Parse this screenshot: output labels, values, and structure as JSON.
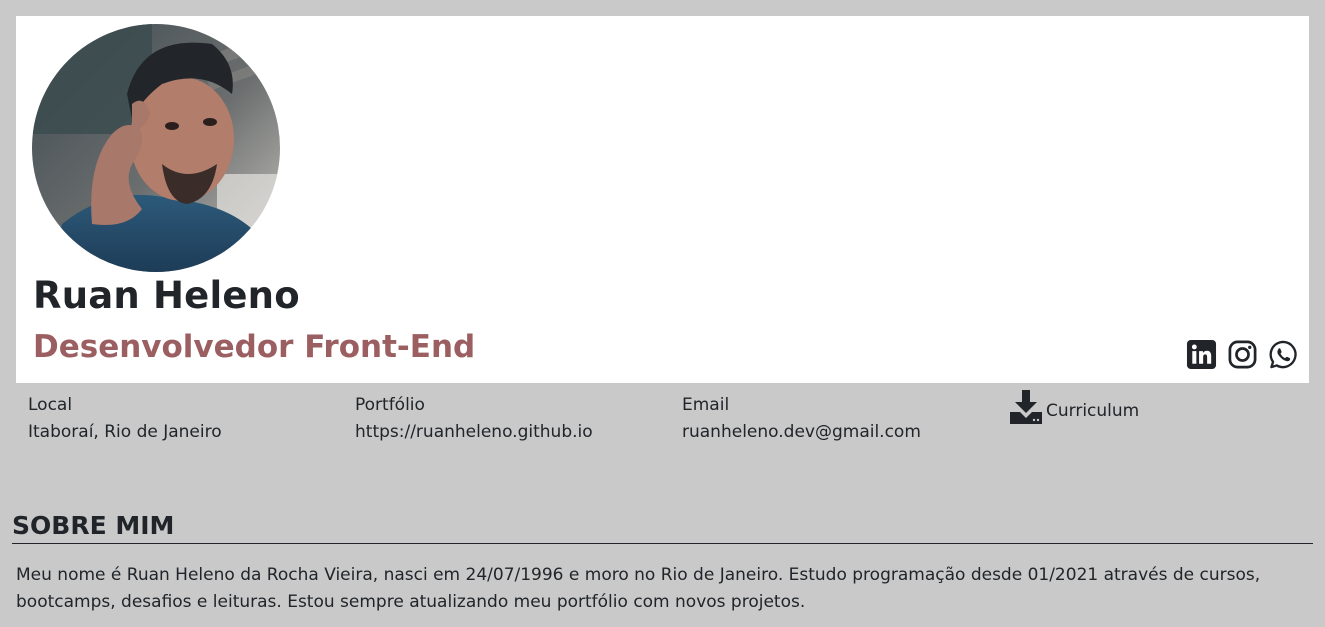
{
  "profile": {
    "name": "Ruan Heleno",
    "role": "Desenvolvedor Front-End",
    "photo_alt": "Foto de perfil"
  },
  "socials": [
    {
      "icon": "linkedin-icon"
    },
    {
      "icon": "instagram-icon"
    },
    {
      "icon": "whatsapp-icon"
    }
  ],
  "info": {
    "local_label": "Local",
    "local_value": "Itaboraí, Rio de Janeiro",
    "portfolio_label": "Portfólio",
    "portfolio_value": "https://ruanheleno.github.io",
    "email_label": "Email",
    "email_value": "ruanheleno.dev@gmail.com",
    "cv_label": "Curriculum",
    "cv_icon": "download-icon"
  },
  "about": {
    "title": "SOBRE MIM",
    "text": "Meu nome é Ruan Heleno da Rocha Vieira, nasci em 24/07/1996 e moro no Rio de Janeiro. Estudo programação desde 01/2021 através de cursos, bootcamps, desafios e leituras. Estou sempre atualizando meu portfólio com novos projetos."
  },
  "colors": {
    "background": "#c9c9c9",
    "card": "#ffffff",
    "text": "#212529",
    "accent": "#9b5e61"
  }
}
